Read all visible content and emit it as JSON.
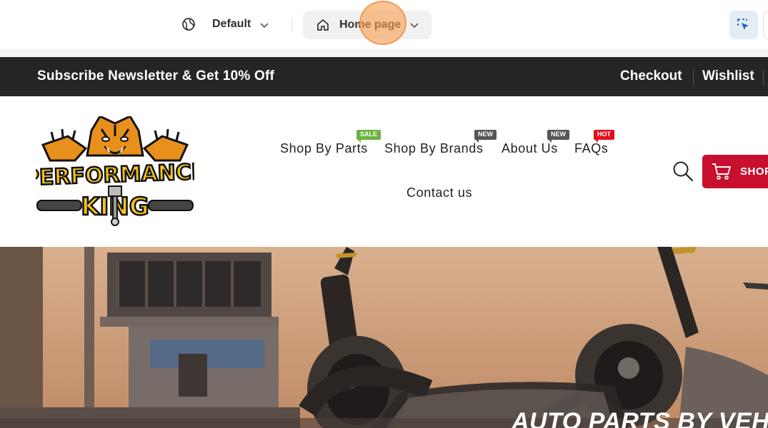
{
  "editor": {
    "locale_label": "Default",
    "page_label": "Home page"
  },
  "announcement": {
    "text": "Subscribe Newsletter & Get 10% Off",
    "links": [
      "Checkout",
      "Wishlist"
    ]
  },
  "header": {
    "logo_text": [
      "PERFORMANCE",
      "KING"
    ],
    "nav": [
      {
        "label": "Shop By Parts",
        "badge": "SALE"
      },
      {
        "label": "Shop By Brands",
        "badge": "NEW"
      },
      {
        "label": "About Us",
        "badge": "NEW"
      },
      {
        "label": "FAQs",
        "badge": "HOT"
      },
      {
        "label": "Contact us",
        "badge": ""
      }
    ],
    "shop_button": "SHOP"
  },
  "hero": {
    "title": "AUTO PARTS BY VEH"
  },
  "icons": [
    "globe-icon",
    "chevron-down-icon",
    "home-icon",
    "inspect-select-icon",
    "search-icon",
    "cart-icon"
  ],
  "colors": {
    "announcement_bg": "#252525",
    "shop_button_bg": "#c8102e",
    "badge_sale": "#6cb33f",
    "badge_new": "#555555",
    "badge_hot": "#e0101a",
    "cursor_highlight": "#f59e50"
  }
}
